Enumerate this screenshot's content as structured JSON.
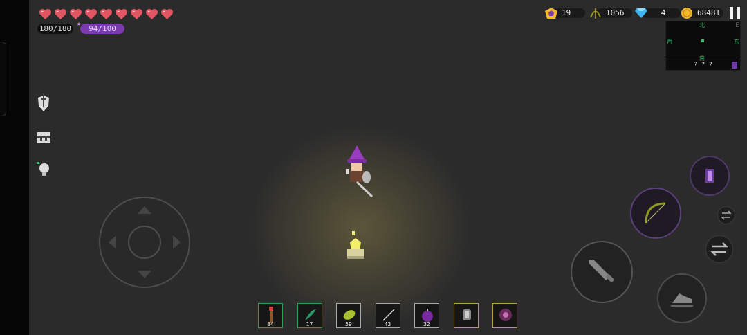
{
  "player": {
    "hearts": 9,
    "hp_text": "180/180",
    "mana_text": "94/100"
  },
  "resources": {
    "level": "19",
    "arrows": "1056",
    "gems": "4",
    "gold": "68481"
  },
  "minimap": {
    "north": "北",
    "south": "南",
    "west": "西",
    "east": "东",
    "corner": "日",
    "floor_label": "? ? ?"
  },
  "hotbar": [
    {
      "icon": "torch-icon",
      "count": "84",
      "border": "green"
    },
    {
      "icon": "herb-icon",
      "count": "17",
      "border": "green"
    },
    {
      "icon": "leaf-icon",
      "count": "59",
      "border": "gray"
    },
    {
      "icon": "needle-icon",
      "count": "43",
      "border": "gray"
    },
    {
      "icon": "bomb-icon",
      "count": "32",
      "border": "gray"
    },
    {
      "icon": "scroll-icon",
      "count": "",
      "border": "gold"
    },
    {
      "icon": "orb-icon",
      "count": "",
      "border": "gold"
    }
  ],
  "colors": {
    "heart": "#e25563",
    "mana": "#7a3bb0",
    "gem": "#3fb6f0",
    "gold": "#f1b82d",
    "bow": "#8e9b1e"
  }
}
